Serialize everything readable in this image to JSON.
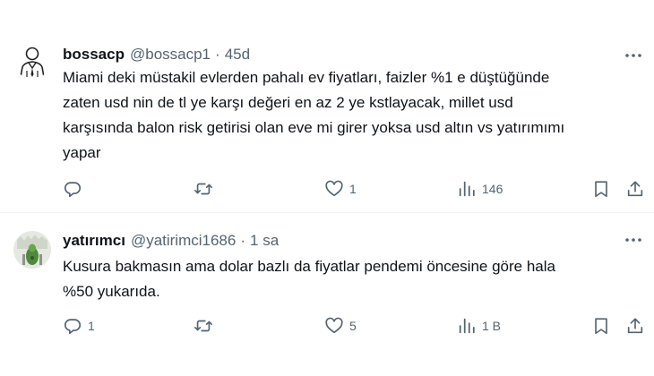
{
  "tweets": [
    {
      "name": "bossacp",
      "handle": "@bossacp1",
      "separator": "·",
      "time": "45d",
      "text": "Miami deki müstakil evlerden pahalı ev fiyatları, faizler %1 e düştüğünde\nzaten usd nin de tl ye karşı değeri en az 2 ye kstlayacak, millet usd\nkarşısında balon risk getirisi olan eve mi girer yoksa usd altın vs yatırımımı\nyapar",
      "replies": "",
      "retweets": "",
      "likes": "1",
      "views": "146"
    },
    {
      "name": "yatırımcı",
      "handle": "@yatirimci1686",
      "separator": "·",
      "time": "1 sa",
      "text": "Kusura bakmasın ama dolar bazlı da fiyatlar pendemi öncesine göre hala\n%50 yukarıda.",
      "replies": "1",
      "retweets": "",
      "likes": "5",
      "views": "1 B"
    }
  ],
  "colors": {
    "text": "#0f1419",
    "secondary": "#536471",
    "divider": "#eff3f4"
  },
  "icons": {
    "reply": "reply-icon",
    "retweet": "retweet-icon",
    "like": "heart-icon",
    "views": "views-icon",
    "bookmark": "bookmark-icon",
    "share": "share-icon",
    "more": "more-icon"
  }
}
